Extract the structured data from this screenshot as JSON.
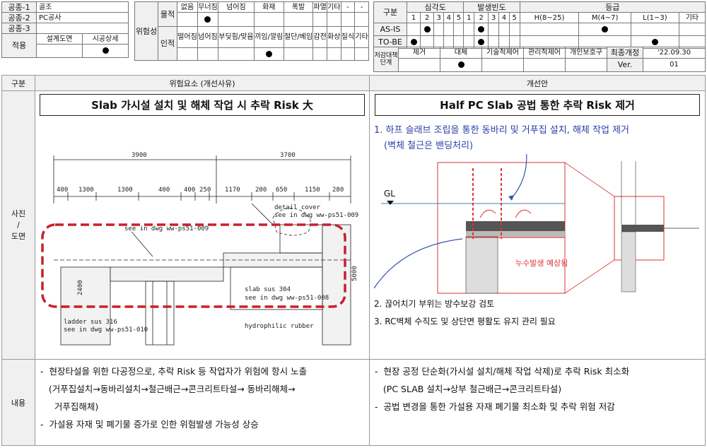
{
  "work": {
    "label1": "공종-1",
    "value1": "골조",
    "label2": "공종-2",
    "value2": "PC공사",
    "label3": "공종-3",
    "value3": "",
    "apply_label": "적용",
    "apply_col1": "설계도면",
    "apply_col2": "시공상세"
  },
  "hazard": {
    "title": "위험성",
    "material_label": "물적",
    "material_cols": [
      "없음",
      "무너짐",
      "넘어짐",
      "화재",
      "폭발",
      "파열",
      "기타",
      "-",
      "-"
    ],
    "human_label": "인적",
    "human_cols": [
      "떨어짐",
      "넘어짐",
      "부딪힘/맞음",
      "끼임/깔림",
      "절단/베임",
      "감전",
      "화상",
      "질식",
      "기타"
    ]
  },
  "grade": {
    "label": "구분",
    "severity": "심각도",
    "frequency": "발생빈도",
    "level": "등급",
    "nums": [
      "1",
      "2",
      "3",
      "4",
      "5"
    ],
    "level_cols": [
      "H(8~25)",
      "M(4~7)",
      "L(1~3)",
      "기타"
    ],
    "asis": "AS-IS",
    "tobe": "TO-BE"
  },
  "measure": {
    "label": "저감대책단계",
    "cols": [
      "제거",
      "대체",
      "기술적제어",
      "관리적제어",
      "개인보호구"
    ],
    "rev_label": "최종개정",
    "rev_date": "'22.09.30",
    "ver_label": "Ver.",
    "ver": "01"
  },
  "main": {
    "col_label": "구분",
    "col_risk": "위험요소 (개선사유)",
    "col_improve": "개선안",
    "row_photo": "사진\n/\n도면",
    "row_content": "내용",
    "risk_title": "Slab 가시설 설치 및 해체 작업 시 추락 Risk 大",
    "improve_title": "Half PC Slab 공법 통한 추락 Risk 제거",
    "improve_note1a": "1. 하프 슬래브 조립을 통한 동바리 및 거푸집 설치, 해체 작업 제거",
    "improve_note1b": "(벽체 철근은 밴딩처리)",
    "improve_note2": "2. 끊어치기 부위는 방수보강 검토",
    "improve_note3": "3. RC벽체 수직도 및 상단면 평활도 유지 관리 필요",
    "leak_label": "누수발생 예상됨",
    "gl_label": "GL",
    "risk_content": [
      "-  현장타설을 위한 다공정으로, 추락 Risk 등 작업자가 위험에 항시 노출",
      "   (거푸집설치→동바리설치→철근배근→콘크리트타설→ 동바리해체→",
      "     거푸집해체)",
      "-  가설용 자재 및 폐기물 증가로 인한 위험발생 가능성 상승"
    ],
    "improve_content": [
      "-  현장 공정 단순화(가시설 설치/해체 작업 삭제)로 추락 Risk 최소화",
      "   (PC SLAB 설치→상부 철근배근→콘크리트타설)",
      "-  공법 변경을 통한 가설용 자재 폐기물 최소화 및 추락 위험 저감"
    ]
  },
  "drawing": {
    "dims_top": [
      "3900",
      "3700"
    ],
    "dims_mid": [
      "400",
      "1300",
      "1300",
      "400",
      "400",
      "250",
      "1170",
      "200",
      "650",
      "1150",
      "280"
    ],
    "callouts": [
      "detail cover",
      "see in dwg ww-ps51-009",
      "see in dwg ww-ps51-009",
      "slab sus 304",
      "see in dwg ww-ps51-008",
      "ladder sus 316",
      "see in dwg ww-ps51-010",
      "hydrophilic rubber",
      "2400",
      "5000"
    ]
  }
}
